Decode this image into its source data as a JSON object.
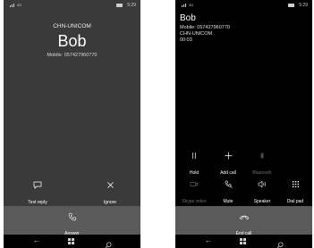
{
  "incoming": {
    "status": {
      "network": "3G",
      "time": "5:29"
    },
    "carrier": "CHN-UNICOM",
    "caller_name": "Bob",
    "caller_number": "Mobile: 057427960770",
    "actions": {
      "text_reply": "Text reply",
      "ignore": "Ignore"
    },
    "answer_label": "Answer"
  },
  "active": {
    "status": {
      "network": "3G",
      "time": "5:29"
    },
    "caller_name": "Bob",
    "caller_number": "Mobile: 057427960770",
    "carrier": "CHN-UNICOM",
    "duration": "00:03",
    "controls": {
      "hold": "Hold",
      "add_call": "Add call",
      "bluetooth": "Bluetooth",
      "skype_video": "Skype video",
      "mute": "Mute",
      "speaker": "Speaker",
      "dial_pad": "Dial pad"
    },
    "end_call_label": "End call"
  },
  "colors": {
    "incoming_background": "#3a3a3a",
    "active_background": "#000000",
    "action_band": "#5a5a5a",
    "disabled_label": "#6f6f6f"
  },
  "icons": {
    "nav_back": "back-arrow-icon",
    "nav_start": "windows-logo-icon",
    "nav_search": "search-icon"
  }
}
